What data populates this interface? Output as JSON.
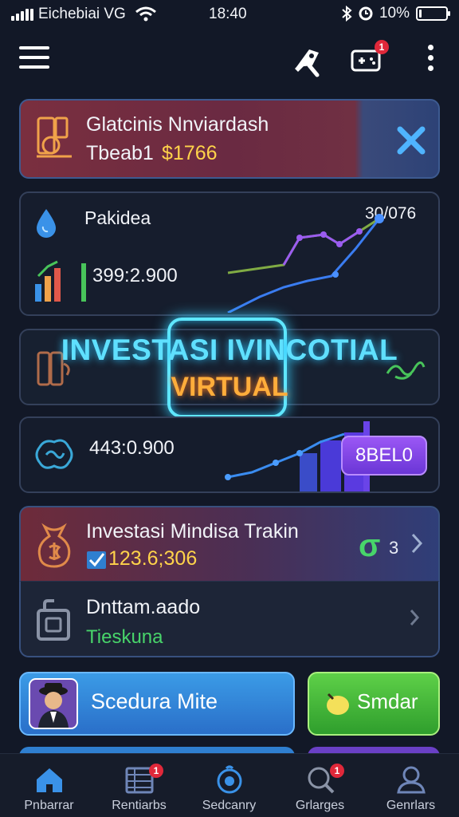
{
  "status_bar": {
    "carrier": "Eichebiai VG",
    "time": "18:40",
    "battery_percent_text": "10%",
    "battery_level": 0.1
  },
  "header": {
    "icons": [
      "menu-icon",
      "rocket-icon",
      "gamepad-icon",
      "kebab-menu-icon"
    ],
    "notification_badge": "1"
  },
  "cards": {
    "top_card": {
      "title": "Glatcinis Nnviardash",
      "sub_prefix": "Tbeab1",
      "sub_value": "$1766",
      "sub_value_color": "#ffd34a"
    },
    "chart_card": {
      "label": "Pakidea",
      "value": "399:2.900",
      "corner_value": "30/076"
    },
    "promo": {
      "line1": "INVESTASI IVINCOTIAL",
      "line2": "VIRTUAL"
    },
    "graph_card": {
      "value": "443:0.900",
      "pill_label": "8BEL0"
    },
    "investment_card": {
      "title": "Investasi Mindisa Trakin",
      "value": "123.6;306",
      "value_color": "#ffd34a",
      "trailing_glyph": "σ",
      "trailing_text": "3"
    },
    "data_card": {
      "title": "Dnttam.aado",
      "subtitle": "Tieskuna",
      "subtitle_color": "#48d46a"
    }
  },
  "buttons": {
    "blue_label": "Scedura Mite",
    "green_label": "Smdar"
  },
  "bottom_nav": {
    "items": [
      {
        "label": "Pnbarrar",
        "icon": "home-icon"
      },
      {
        "label": "Rentiarbs",
        "icon": "table-icon",
        "badge": "1"
      },
      {
        "label": "Sedcanry",
        "icon": "target-icon"
      },
      {
        "label": "Grlarges",
        "icon": "search-icon",
        "badge": "1"
      },
      {
        "label": "Genrlars",
        "icon": "user-icon"
      }
    ]
  },
  "colors": {
    "background": "#121827",
    "accent_cyan": "#5fe0ff",
    "accent_orange": "#ffad3b",
    "accent_purple": "#8b4cf0",
    "accent_green": "#48d46a"
  }
}
